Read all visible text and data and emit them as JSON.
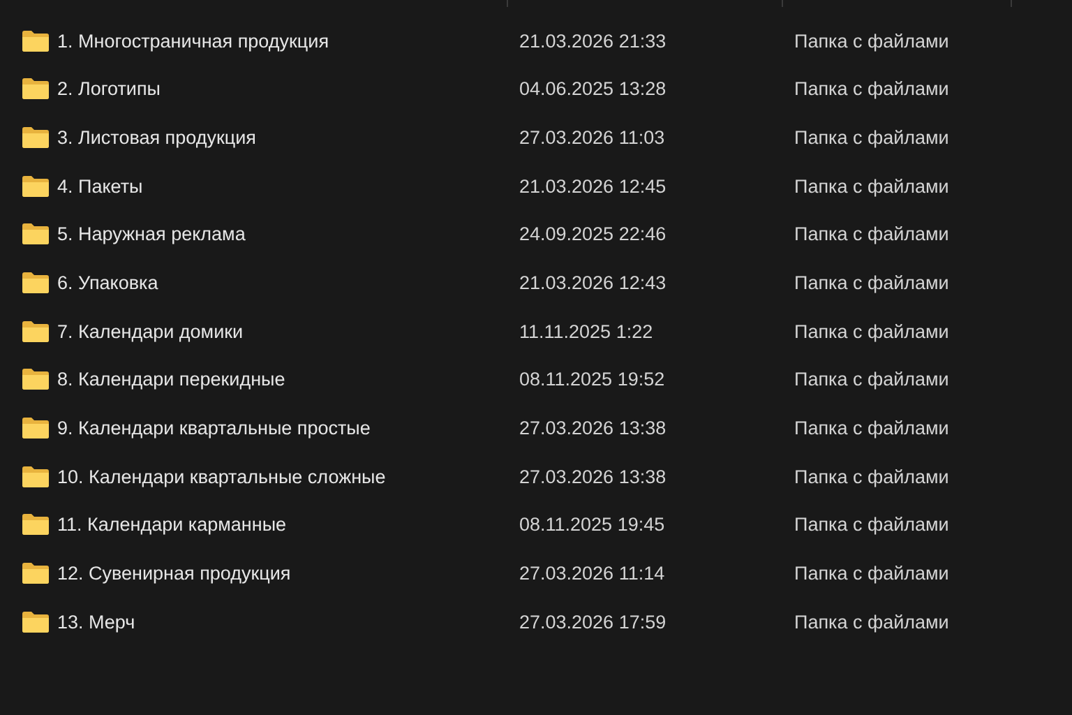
{
  "rows": [
    {
      "name": "1. Многостраничная продукция",
      "modified": "21.03.2026 21:33",
      "type": "Папка с файлами"
    },
    {
      "name": "2. Логотипы",
      "modified": "04.06.2025 13:28",
      "type": "Папка с файлами"
    },
    {
      "name": "3. Листовая продукция",
      "modified": "27.03.2026 11:03",
      "type": "Папка с файлами"
    },
    {
      "name": "4. Пакеты",
      "modified": "21.03.2026 12:45",
      "type": "Папка с файлами"
    },
    {
      "name": "5. Наружная реклама",
      "modified": "24.09.2025 22:46",
      "type": "Папка с файлами"
    },
    {
      "name": "6. Упаковка",
      "modified": "21.03.2026 12:43",
      "type": "Папка с файлами"
    },
    {
      "name": "7. Календари домики",
      "modified": "11.11.2025 1:22",
      "type": "Папка с файлами"
    },
    {
      "name": "8. Календари перекидные",
      "modified": "08.11.2025 19:52",
      "type": "Папка с файлами"
    },
    {
      "name": "9. Календари квартальные простые",
      "modified": "27.03.2026 13:38",
      "type": "Папка с файлами"
    },
    {
      "name": "10. Календари квартальные сложные",
      "modified": "27.03.2026 13:38",
      "type": "Папка с файлами"
    },
    {
      "name": "11. Календари карманные",
      "modified": "08.11.2025 19:45",
      "type": "Папка с файлами"
    },
    {
      "name": "12. Сувенирная продукция",
      "modified": "27.03.2026 11:14",
      "type": "Папка с файлами"
    },
    {
      "name": "13. Мерч",
      "modified": "27.03.2026 17:59",
      "type": "Папка с файлами"
    }
  ]
}
